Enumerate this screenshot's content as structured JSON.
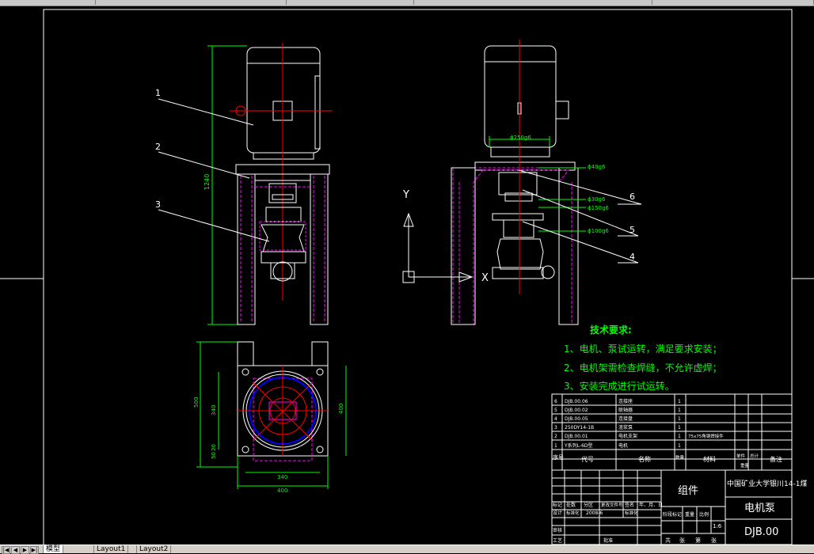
{
  "tabs": {
    "model": "模型",
    "layout1": "Layout1",
    "layout2": "Layout2"
  },
  "balloons": [
    "1",
    "2",
    "3",
    "4",
    "5",
    "6"
  ],
  "axis": {
    "y": "Y",
    "x": "X"
  },
  "dims": {
    "height": "1240",
    "d250": "ϕ250g6",
    "d40": "ϕ40g6",
    "d30": "ϕ30g6",
    "d150": "ϕ150g6",
    "d100": "ϕ100g6",
    "v500": "500",
    "v340": "340",
    "v400r": "400",
    "v50a": "50",
    "v20": "20",
    "h340": "340",
    "h400": "400"
  },
  "requirements": {
    "title": "技术要求:",
    "items": [
      "1、电机、泵试运转，满足要求安装；",
      "2、电机架需检查焊缝，不允许虚焊；",
      "3、安装完成进行试运转。"
    ]
  },
  "bom": {
    "rows": [
      {
        "no": "6",
        "code": "DJB.00.06",
        "name": "连接座",
        "qty": "1",
        "material": ""
      },
      {
        "no": "5",
        "code": "DJB.00.02",
        "name": "联轴器",
        "qty": "1",
        "material": ""
      },
      {
        "no": "4",
        "code": "DJB.00.05",
        "name": "连接盘",
        "qty": "1",
        "material": ""
      },
      {
        "no": "3",
        "code": "250DY14-1B",
        "name": "渣浆泵",
        "qty": "1",
        "material": ""
      },
      {
        "no": "2",
        "code": "DJB.00.01",
        "name": "电机支架",
        "qty": "1",
        "material": "75x75角钢焊接件"
      },
      {
        "no": "1",
        "code": "Y系列L-6D型",
        "name": "电机",
        "qty": "1",
        "material": ""
      }
    ],
    "header": {
      "no": "序号",
      "code": "代号",
      "name": "名称",
      "qty": "数量",
      "material": "材料",
      "weight_unit": "单件",
      "weight_total": "总计",
      "weight": "重量",
      "note": "备注"
    }
  },
  "title_block": {
    "assembly": "组件",
    "school": "中国矿业大学银川14-1煤",
    "drawing_name": "电机泵",
    "drawing_no": "DJB.00",
    "scale": "1:6",
    "rev_labels": [
      "标记",
      "处数",
      "分区",
      "更改文件号",
      "签名",
      "年、月、日"
    ],
    "designer_label": "设计",
    "std_label": "标准化",
    "date": "2008-6",
    "std_value": "标准化",
    "review_label": "审核",
    "process_label": "工艺",
    "approve_label": "批准",
    "stage_labels": [
      "阶段标记",
      "重量",
      "比例"
    ],
    "sheet_labels": [
      "共",
      "张",
      "第",
      "张"
    ]
  }
}
